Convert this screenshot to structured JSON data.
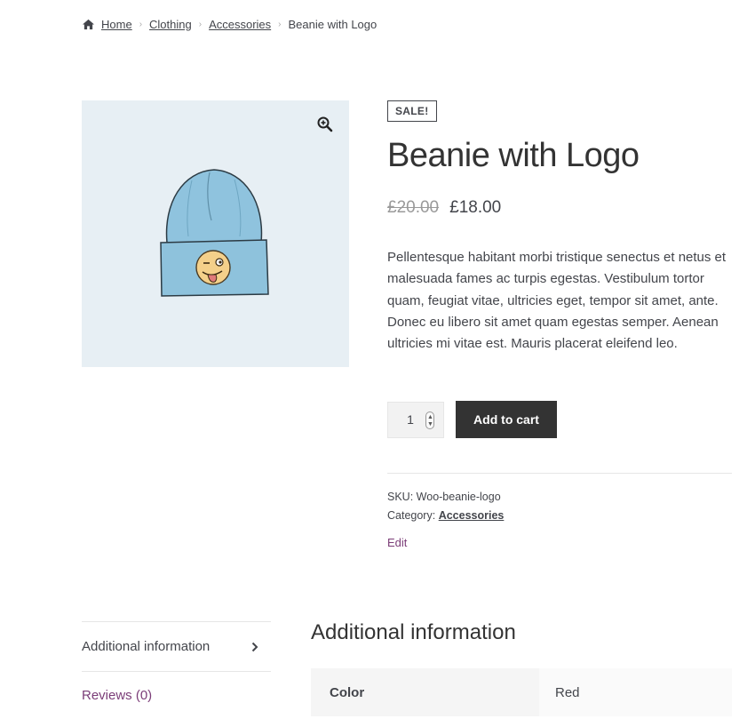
{
  "breadcrumb": {
    "icon": "home-icon",
    "items": [
      "Home",
      "Clothing",
      "Accessories"
    ],
    "current": "Beanie with Logo"
  },
  "gallery": {
    "zoom_icon": "magnifier-plus-icon",
    "image_icon": "beanie-with-logo-illustration"
  },
  "product": {
    "badge": "SALE!",
    "title": "Beanie with Logo",
    "price_old": "£20.00",
    "price_new": "£18.00",
    "description": "Pellentesque habitant morbi tristique senectus et netus et malesuada fames ac turpis egestas. Vestibulum tortor quam, feugiat vitae, ultricies eget, tempor sit amet, ante. Donec eu libero sit amet quam egestas semper. Aenean ultricies mi vitae est. Mauris placerat eleifend leo."
  },
  "cart": {
    "quantity": "1",
    "add_label": "Add to cart"
  },
  "meta": {
    "sku_label": "SKU:",
    "sku_value": "Woo-beanie-logo",
    "category_label": "Category:",
    "category_value": "Accessories",
    "edit_label": "Edit"
  },
  "tabs": {
    "items": [
      "Additional information",
      "Reviews (0)"
    ]
  },
  "panel": {
    "title": "Additional information",
    "rows": [
      {
        "label": "Color",
        "value": "Red"
      }
    ]
  },
  "colors": {
    "accent": "#7b3d78",
    "button": "#333333",
    "image_bg": "#e7eff4"
  }
}
